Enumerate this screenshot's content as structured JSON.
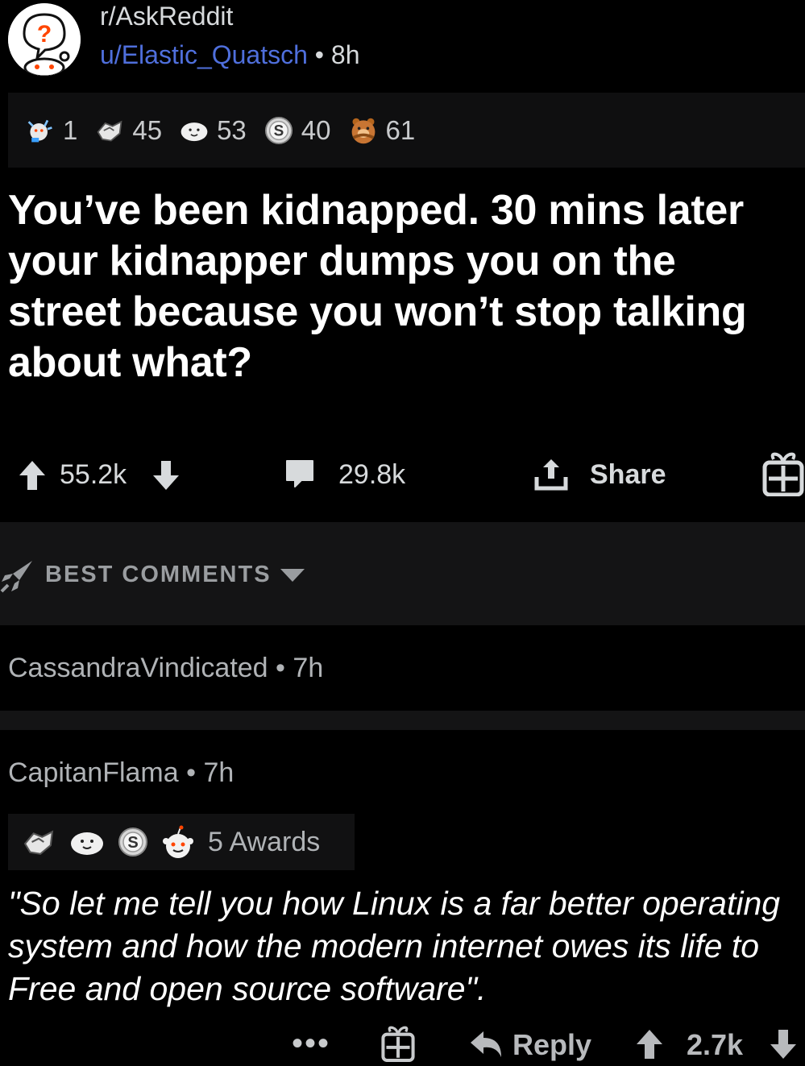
{
  "post": {
    "subreddit": "r/AskReddit",
    "username": "u/Elastic_Quatsch",
    "separator": "•",
    "age": "8h",
    "title": "You’ve been kidnapped. 30 mins later your kidnapper dumps you on the street because you won’t stop talking about what?"
  },
  "awards": [
    {
      "icon": "party-award-icon",
      "count": "1"
    },
    {
      "icon": "handshake-award-icon",
      "count": "45"
    },
    {
      "icon": "wholesome-seal-award-icon",
      "count": "53"
    },
    {
      "icon": "silver-award-icon",
      "count": "40"
    },
    {
      "icon": "hugz-bear-award-icon",
      "count": "61"
    }
  ],
  "actions": {
    "score": "55.2k",
    "comments": "29.8k",
    "share_label": "Share"
  },
  "sort": {
    "label": "BEST COMMENTS"
  },
  "comments": [
    {
      "author": "CassandraVindicated",
      "separator": "•",
      "age": "7h"
    },
    {
      "author": "CapitanFlama",
      "separator": "•",
      "age": "7h",
      "awards_label": "5 Awards",
      "body": "\"So let me tell you how Linux is a far better operating system and how the modern internet owes its life to Free and open source software\".",
      "more": "•••",
      "reply_label": "Reply",
      "score": "2.7k"
    }
  ],
  "colors": {
    "background": "#000000",
    "username": "#4f6fdc",
    "panel": "#141415"
  }
}
